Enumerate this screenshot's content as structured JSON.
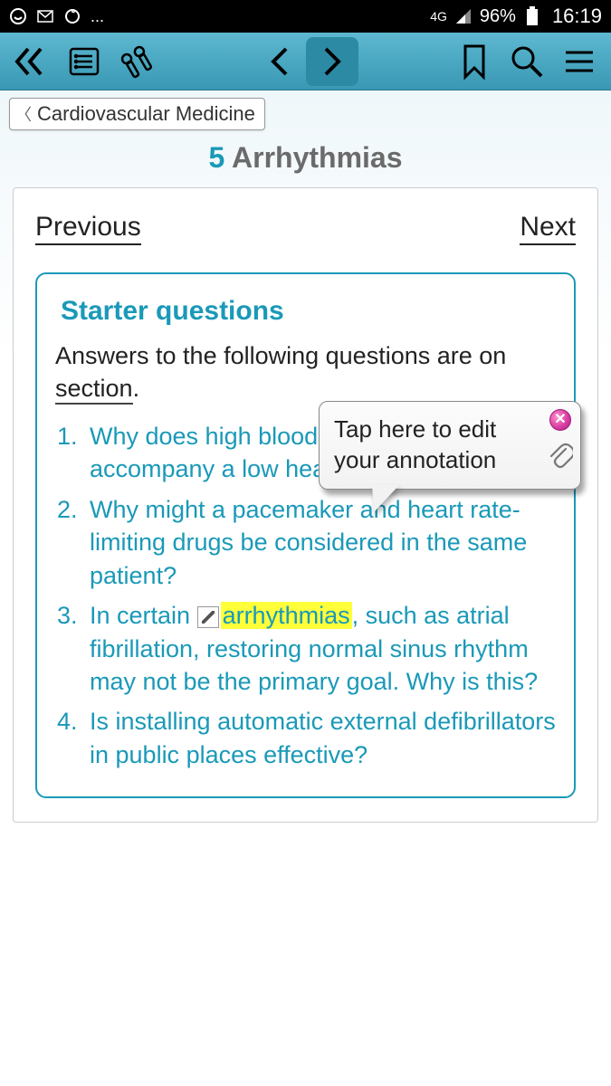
{
  "status": {
    "network": "4G",
    "battery": "96%",
    "time": "16:19"
  },
  "breadcrumb": {
    "label": "Cardiovascular Medicine"
  },
  "title": {
    "number": "5",
    "text": "Arrhythmias"
  },
  "nav": {
    "prev": "Previous",
    "next": "Next"
  },
  "section": {
    "heading": "Starter questions",
    "intro_pre": "Answers to the following questions are on ",
    "intro_link": "section",
    "intro_post": "."
  },
  "questions": {
    "q1": "Why does high blood pressure often accompany a low heart rate?",
    "q2_pre": "Why might a pacemaker and heart rate-limiting drugs be considered in the same patient?",
    "q3_pre": "In certain ",
    "q3_hl": "arrhythmias",
    "q3_post": ", such as atrial fibrillation, restoring normal sinus rhythm may not be the primary goal. Why is this?",
    "q4": "Is installing automatic external defibrillators in public places effective?"
  },
  "popup": {
    "text": "Tap here to edit your annotation"
  }
}
